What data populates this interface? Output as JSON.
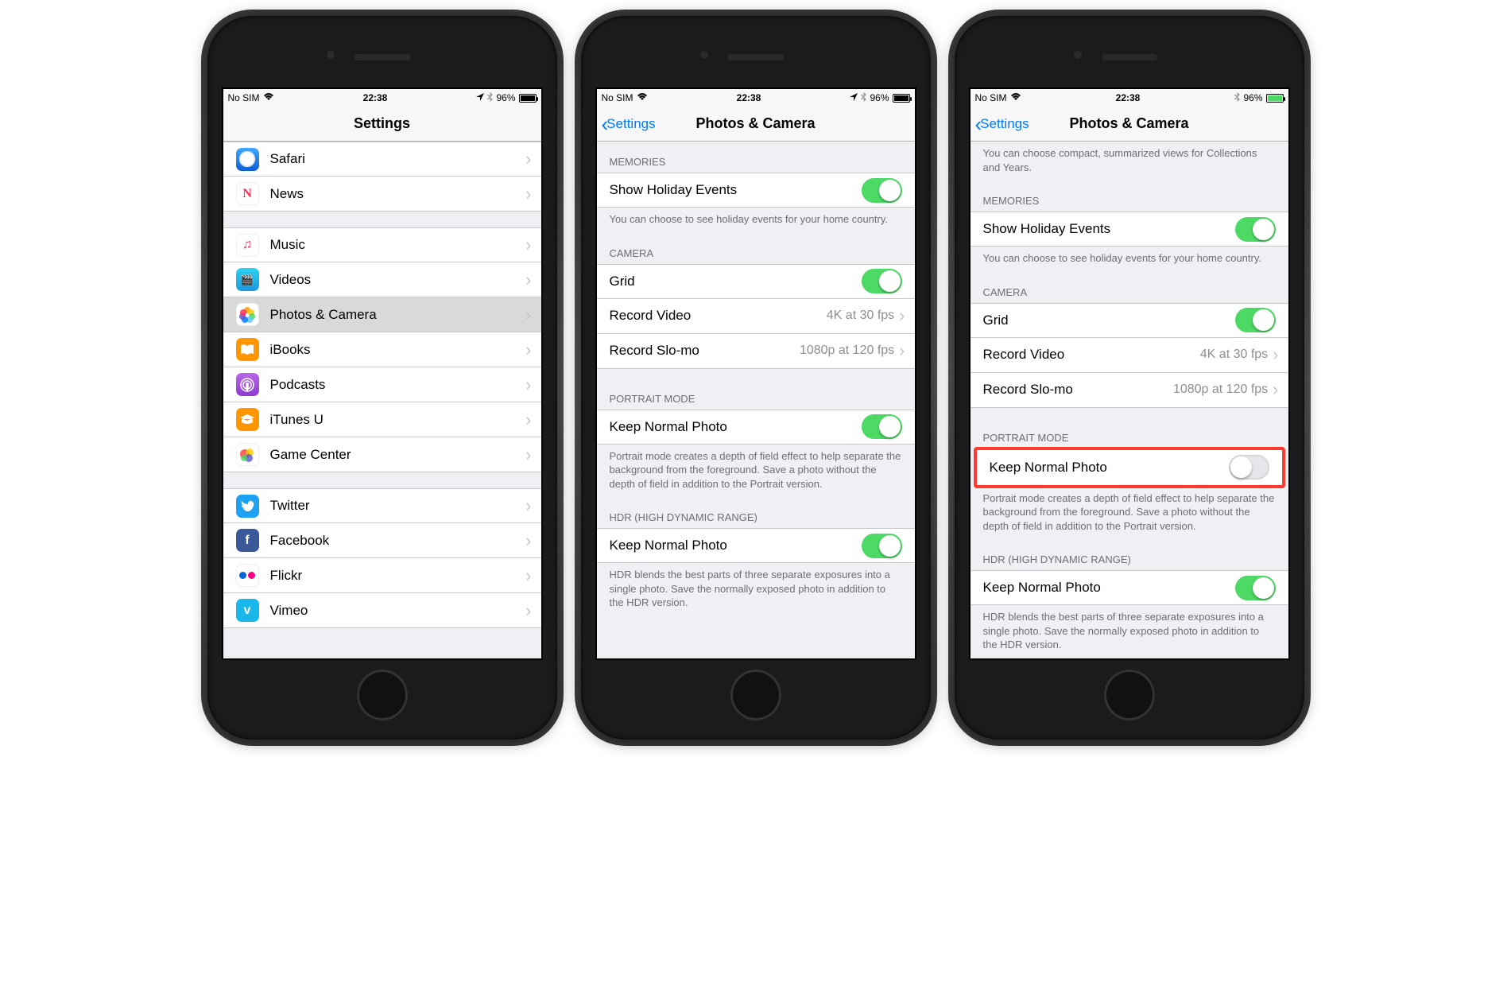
{
  "status": {
    "carrier": "No SIM",
    "time": "22:38",
    "battery": "96%"
  },
  "phone1": {
    "title": "Settings",
    "rows": {
      "safari": "Safari",
      "news": "News",
      "music": "Music",
      "videos": "Videos",
      "photos": "Photos & Camera",
      "ibooks": "iBooks",
      "podcasts": "Podcasts",
      "itunesu": "iTunes U",
      "gamecenter": "Game Center",
      "twitter": "Twitter",
      "facebook": "Facebook",
      "flickr": "Flickr",
      "vimeo": "Vimeo"
    }
  },
  "phone2": {
    "back": "Settings",
    "title": "Photos & Camera",
    "sections": {
      "memories_header": "MEMORIES",
      "show_holiday": "Show Holiday Events",
      "memories_footer": "You can choose to see holiday events for your home country.",
      "camera_header": "CAMERA",
      "grid": "Grid",
      "record_video": "Record Video",
      "record_video_val": "4K at 30 fps",
      "record_slomo": "Record Slo-mo",
      "record_slomo_val": "1080p at 120 fps",
      "portrait_header": "PORTRAIT MODE",
      "keep_normal_portrait": "Keep Normal Photo",
      "portrait_footer": "Portrait mode creates a depth of field effect to help separate the background from the foreground. Save a photo without the depth of field in addition to the Portrait version.",
      "hdr_header": "HDR (HIGH DYNAMIC RANGE)",
      "keep_normal_hdr": "Keep Normal Photo",
      "hdr_footer": "HDR blends the best parts of three separate exposures into a single photo. Save the normally exposed photo in addition to the HDR version."
    }
  },
  "phone3": {
    "back": "Settings",
    "title": "Photos & Camera",
    "top_footer": "You can choose compact, summarized views for Collections and Years.",
    "sections": {
      "memories_header": "MEMORIES",
      "show_holiday": "Show Holiday Events",
      "memories_footer": "You can choose to see holiday events for your home country.",
      "camera_header": "CAMERA",
      "grid": "Grid",
      "record_video": "Record Video",
      "record_video_val": "4K at 30 fps",
      "record_slomo": "Record Slo-mo",
      "record_slomo_val": "1080p at 120 fps",
      "portrait_header": "PORTRAIT MODE",
      "keep_normal_portrait": "Keep Normal Photo",
      "portrait_footer": "Portrait mode creates a depth of field effect to help separate the background from the foreground. Save a photo without the depth of field in addition to the Portrait version.",
      "hdr_header": "HDR (HIGH DYNAMIC RANGE)",
      "keep_normal_hdr": "Keep Normal Photo",
      "hdr_footer": "HDR blends the best parts of three separate exposures into a single photo. Save the normally exposed photo in addition to the HDR version."
    }
  }
}
